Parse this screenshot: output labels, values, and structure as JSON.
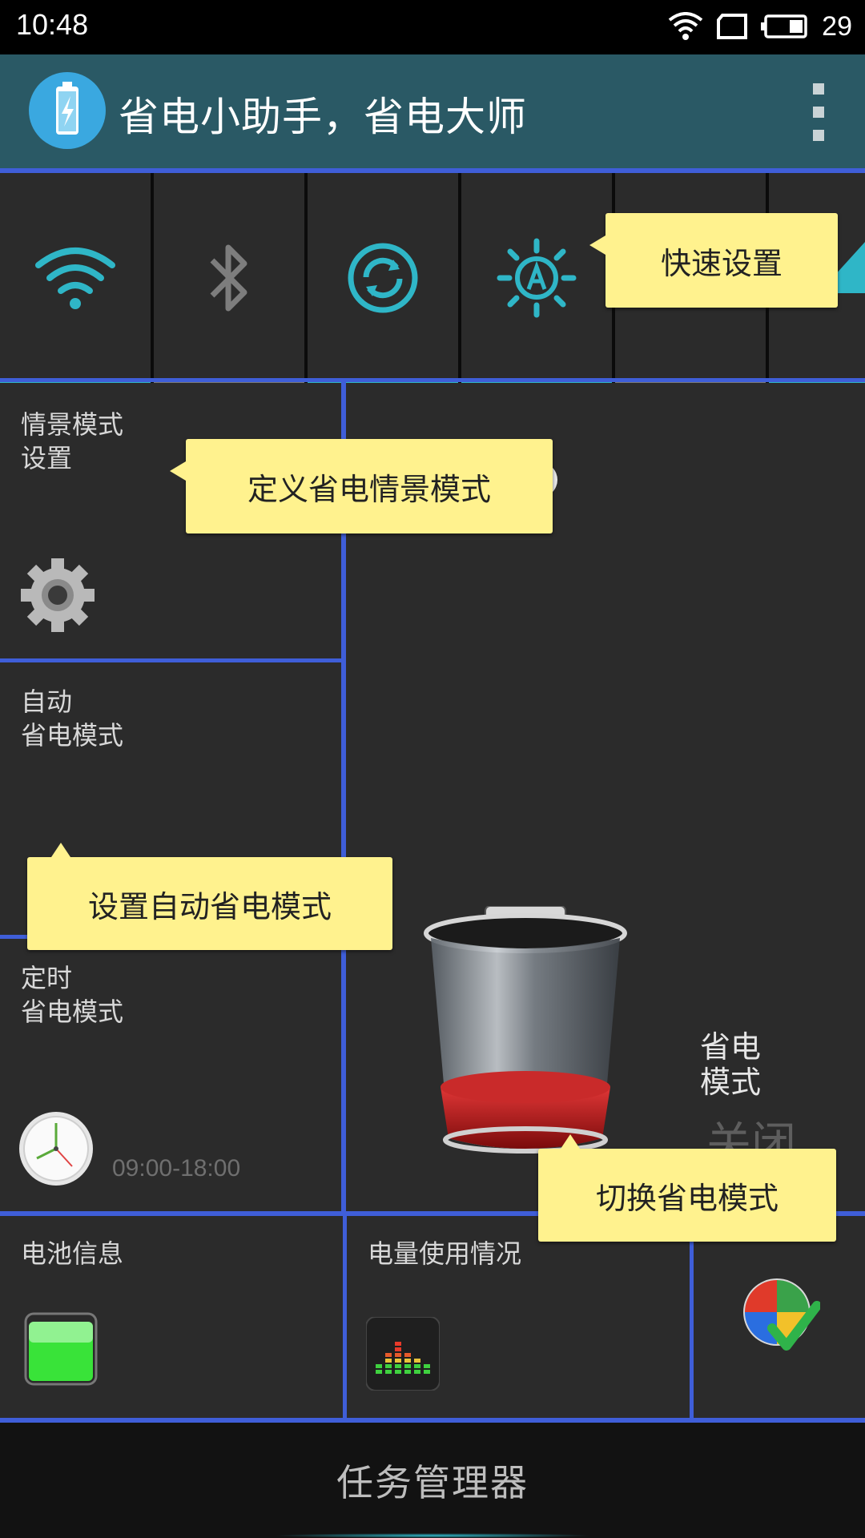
{
  "status": {
    "time": "10:48",
    "battery_pct": "29"
  },
  "app": {
    "title": "省电小助手，省电大师"
  },
  "tiles": {
    "scene": {
      "line1": "情景模式",
      "line2": "设置"
    },
    "auto": {
      "line1": "自动",
      "line2": "省电模式"
    },
    "timer": {
      "line1": "定时",
      "line2": "省电模式",
      "range": "09:00-18:00"
    },
    "mode": {
      "line1": "省电",
      "line2": "模式",
      "state": "关闭"
    },
    "battery_info": {
      "label": "电池信息"
    },
    "usage": {
      "label": "电量使用情况"
    }
  },
  "tooltips": {
    "quick": "快速设置",
    "scene": "定义省电情景模式",
    "auto": "设置自动省电模式",
    "toggle": "切换省电模式"
  },
  "bottom": {
    "task_manager": "任务管理器"
  },
  "colors": {
    "accent_blue": "#3f5ed8",
    "cyan": "#2fb6c7",
    "appbar": "#2a5965",
    "tooltip": "#fff28e"
  }
}
